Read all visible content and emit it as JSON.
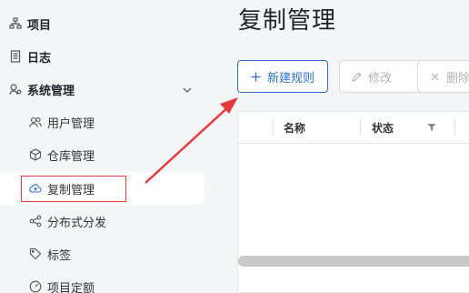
{
  "sidebar": {
    "items": [
      {
        "label": "项目",
        "icon": "project-icon"
      },
      {
        "label": "日志",
        "icon": "log-icon"
      },
      {
        "label": "系统管理",
        "icon": "system-settings-icon",
        "expanded": true
      },
      {
        "label": "用户管理",
        "icon": "users-icon"
      },
      {
        "label": "仓库管理",
        "icon": "box-icon"
      },
      {
        "label": "复制管理",
        "icon": "cloud-sync-icon",
        "active": true
      },
      {
        "label": "分布式分发",
        "icon": "share-icon"
      },
      {
        "label": "标签",
        "icon": "tag-icon"
      },
      {
        "label": "项目定额",
        "icon": "quota-icon"
      }
    ]
  },
  "main": {
    "title": "复制管理",
    "toolbar": {
      "new_label": "新建规则",
      "edit_label": "修改",
      "delete_label": "删除"
    },
    "table": {
      "columns": [
        "名称",
        "状态"
      ]
    }
  },
  "annotation": {
    "box_color": "#e33b3b",
    "arrow_color": "#e33b3b"
  },
  "colors": {
    "primary": "#2d6ec9",
    "disabled": "#b3b3b3"
  }
}
